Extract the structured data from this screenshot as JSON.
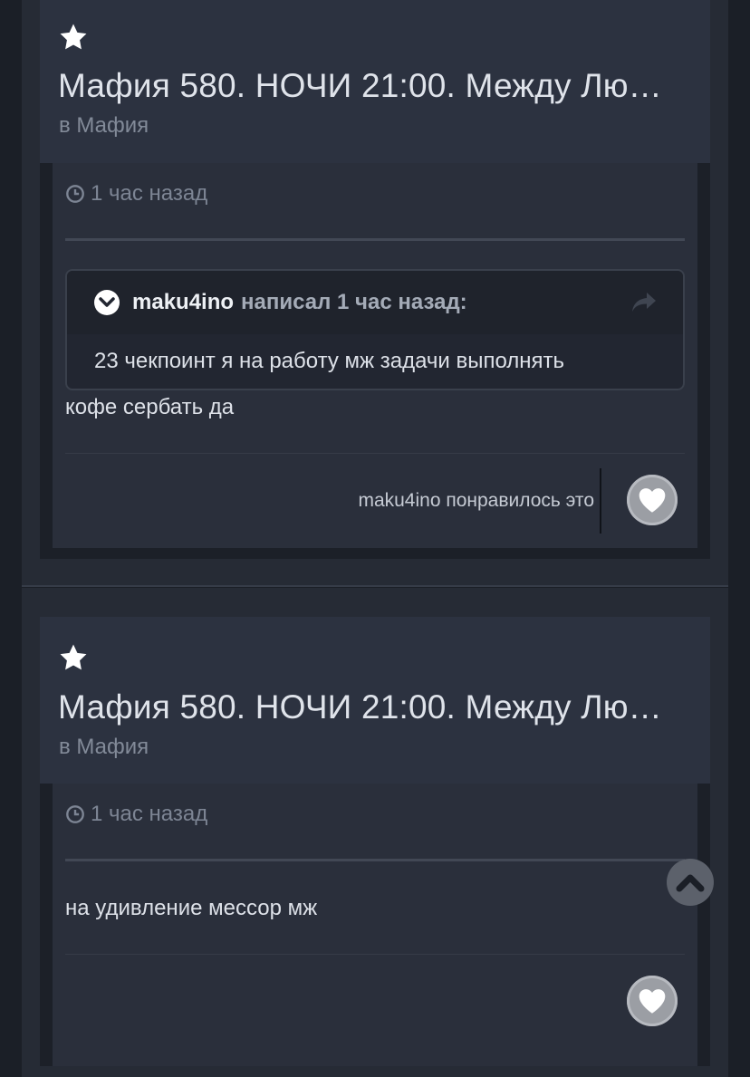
{
  "activity": [
    {
      "topic_title": "Мафия 580. НОЧИ 21:00. Между Лю…",
      "forum": "в Мафия",
      "time": "1 час назад",
      "quote": {
        "author": "maku4ino",
        "wrote": "написал 1 час назад:",
        "text": "23 чекпоинт я на работу мж задачи выполнять"
      },
      "body": "кофе сербать да",
      "likes": "maku4ino понравилось это"
    },
    {
      "topic_title": "Мафия 580. НОЧИ 21:00. Между Лю…",
      "forum": "в Мафия",
      "time": "1 час назад",
      "body": "на удивление мессор мж"
    }
  ],
  "icons": {
    "star": "star-icon",
    "clock": "clock-icon",
    "chevron": "chevron-down-icon",
    "share": "share-icon",
    "heart": "heart-icon",
    "scroll_top": "chevron-up-icon"
  },
  "colors": {
    "background": "#1b1f27",
    "card": "#2a2f3b",
    "text": "#dde1e8",
    "muted": "#7d8594"
  }
}
